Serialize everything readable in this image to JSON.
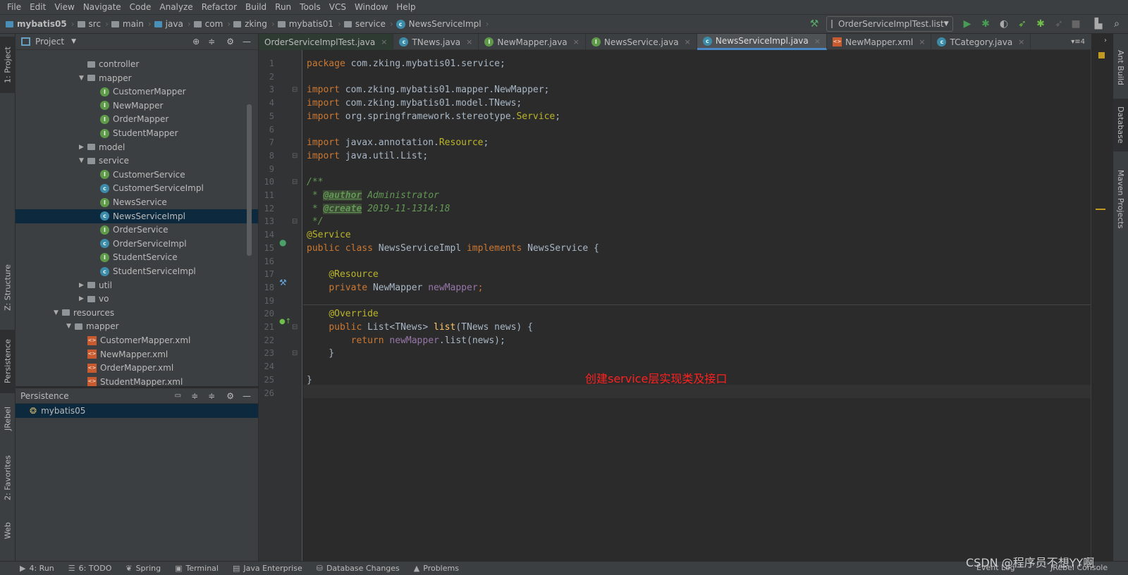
{
  "menu": [
    "File",
    "Edit",
    "View",
    "Navigate",
    "Code",
    "Analyze",
    "Refactor",
    "Build",
    "Run",
    "Tools",
    "VCS",
    "Window",
    "Help"
  ],
  "breadcrumb": [
    {
      "label": "mybatis05",
      "icon": "module-icon"
    },
    {
      "label": "src",
      "icon": "folder-icon"
    },
    {
      "label": "main",
      "icon": "folder-icon"
    },
    {
      "label": "java",
      "icon": "source-folder-icon"
    },
    {
      "label": "com",
      "icon": "package-icon"
    },
    {
      "label": "zking",
      "icon": "package-icon"
    },
    {
      "label": "mybatis01",
      "icon": "package-icon"
    },
    {
      "label": "service",
      "icon": "package-icon"
    },
    {
      "label": "NewsServiceImpl",
      "icon": "class-icon"
    }
  ],
  "toolbar": {
    "run_config": "OrderServiceImplTest.list"
  },
  "left_tabs": {
    "project": "1: Project",
    "structure": "Z: Structure",
    "persistence": "Persistence",
    "jrebel": "JRebel",
    "favorites": "2: Favorites",
    "web": "Web"
  },
  "right_tabs": {
    "ant": "Ant Build",
    "database": "Database",
    "maven": "Maven Projects"
  },
  "project": {
    "title": "Project",
    "tree": [
      {
        "label": "controller",
        "type": "package",
        "level": 2,
        "arrow": ""
      },
      {
        "label": "mapper",
        "type": "package",
        "level": 2,
        "arrow": "down"
      },
      {
        "label": "CustomerMapper",
        "type": "interface",
        "level": 3
      },
      {
        "label": "NewMapper",
        "type": "interface",
        "level": 3
      },
      {
        "label": "OrderMapper",
        "type": "interface",
        "level": 3
      },
      {
        "label": "StudentMapper",
        "type": "interface",
        "level": 3
      },
      {
        "label": "model",
        "type": "package",
        "level": 2,
        "arrow": "right"
      },
      {
        "label": "service",
        "type": "package",
        "level": 2,
        "arrow": "down"
      },
      {
        "label": "CustomerService",
        "type": "interface",
        "level": 3
      },
      {
        "label": "CustomerServiceImpl",
        "type": "class",
        "level": 3
      },
      {
        "label": "NewsService",
        "type": "interface",
        "level": 3
      },
      {
        "label": "NewsServiceImpl",
        "type": "class",
        "level": 3,
        "selected": true
      },
      {
        "label": "OrderService",
        "type": "interface",
        "level": 3
      },
      {
        "label": "OrderServiceImpl",
        "type": "class",
        "level": 3
      },
      {
        "label": "StudentService",
        "type": "interface",
        "level": 3
      },
      {
        "label": "StudentServiceImpl",
        "type": "class",
        "level": 3
      },
      {
        "label": "util",
        "type": "package",
        "level": 2,
        "arrow": "right"
      },
      {
        "label": "vo",
        "type": "package",
        "level": 2,
        "arrow": "right"
      },
      {
        "label": "resources",
        "type": "resources",
        "level": 0,
        "arrow": "down"
      },
      {
        "label": "mapper",
        "type": "package",
        "level": 1,
        "arrow": "down"
      },
      {
        "label": "CustomerMapper.xml",
        "type": "xml",
        "level": 2
      },
      {
        "label": "NewMapper.xml",
        "type": "xml",
        "level": 2
      },
      {
        "label": "OrderMapper.xml",
        "type": "xml",
        "level": 2
      },
      {
        "label": "StudentMapper.xml",
        "type": "xml",
        "level": 2
      }
    ]
  },
  "persistence": {
    "title": "Persistence",
    "items": [
      "mybatis05"
    ]
  },
  "tabs": [
    {
      "label": "OrderServiceImplTest.java",
      "type": "none"
    },
    {
      "label": "TNews.java",
      "type": "class"
    },
    {
      "label": "NewMapper.java",
      "type": "interface"
    },
    {
      "label": "NewsService.java",
      "type": "interface"
    },
    {
      "label": "NewsServiceImpl.java",
      "type": "class",
      "active": true
    },
    {
      "label": "NewMapper.xml",
      "type": "xml"
    },
    {
      "label": "TCategory.java",
      "type": "class"
    }
  ],
  "tabs_overflow": "4",
  "code": [
    [
      [
        "kw",
        "package "
      ],
      [
        "",
        "com.zking.mybatis01.service;"
      ]
    ],
    [],
    [
      [
        "kw",
        "import "
      ],
      [
        "",
        "com.zking.mybatis01.mapper.NewMapper;"
      ]
    ],
    [
      [
        "kw",
        "import "
      ],
      [
        "",
        "com.zking.mybatis01.model.TNews;"
      ]
    ],
    [
      [
        "kw",
        "import "
      ],
      [
        "",
        "org.springframework.stereotype."
      ],
      [
        "an",
        "Service"
      ],
      [
        "",
        ";"
      ]
    ],
    [],
    [
      [
        "kw",
        "import "
      ],
      [
        "",
        "javax.annotation."
      ],
      [
        "an",
        "Resource"
      ],
      [
        "",
        ";"
      ]
    ],
    [
      [
        "kw",
        "import "
      ],
      [
        "",
        "java.util.List;"
      ]
    ],
    [],
    [
      [
        "cm",
        "/**"
      ]
    ],
    [
      [
        "cm",
        " * "
      ],
      [
        "tag",
        "@author"
      ],
      [
        "cm",
        " Administrator"
      ]
    ],
    [
      [
        "cm",
        " * "
      ],
      [
        "tag",
        "@create"
      ],
      [
        "cm",
        " 2019-11-1314:18"
      ]
    ],
    [
      [
        "cm",
        " */"
      ]
    ],
    [
      [
        "an",
        "@Service"
      ]
    ],
    [
      [
        "kw",
        "public class "
      ],
      [
        "",
        "NewsServiceImpl "
      ],
      [
        "kw",
        "implements "
      ],
      [
        "",
        "NewsService {"
      ]
    ],
    [],
    [
      [
        "",
        "    "
      ],
      [
        "an",
        "@Resource"
      ]
    ],
    [
      [
        "",
        "    "
      ],
      [
        "kw",
        "private "
      ],
      [
        "",
        "NewMapper "
      ],
      [
        "fd",
        "newMapper"
      ],
      [
        "kw",
        ";"
      ]
    ],
    [],
    [
      [
        "",
        "    "
      ],
      [
        "an",
        "@Override"
      ]
    ],
    [
      [
        "",
        "    "
      ],
      [
        "kw",
        "public "
      ],
      [
        "",
        "List<TNews> "
      ],
      [
        "fn",
        "list"
      ],
      [
        "",
        "(TNews news) {"
      ]
    ],
    [
      [
        "",
        "        "
      ],
      [
        "kw",
        "return "
      ],
      [
        "fd",
        "newMapper"
      ],
      [
        "",
        ".list(news);"
      ]
    ],
    [
      [
        "",
        "    }"
      ]
    ],
    [],
    [
      [
        "",
        "}"
      ]
    ],
    []
  ],
  "annotation_note": "创建service层实现类及接口",
  "bottom_tools": [
    {
      "label": "4: Run",
      "icon": "run-icon"
    },
    {
      "label": "6: TODO",
      "icon": "todo-icon"
    },
    {
      "label": "Spring",
      "icon": "spring-icon"
    },
    {
      "label": "Terminal",
      "icon": "terminal-icon"
    },
    {
      "label": "Java Enterprise",
      "icon": "java-enterprise-icon"
    },
    {
      "label": "Database Changes",
      "icon": "database-changes-icon"
    },
    {
      "label": "Problems",
      "icon": "problems-icon"
    }
  ],
  "bottom_right": {
    "event_log": "Event Log",
    "jrebel_console": "JRebel Console"
  },
  "watermark": "CSDN @程序员不想YY啊",
  "colors": {
    "keyword": "#cc7832",
    "annotation": "#bbb529",
    "comment": "#629755",
    "field": "#9876aa",
    "method": "#ffc66d",
    "selection": "#0d293e",
    "note": "#ff2020"
  }
}
